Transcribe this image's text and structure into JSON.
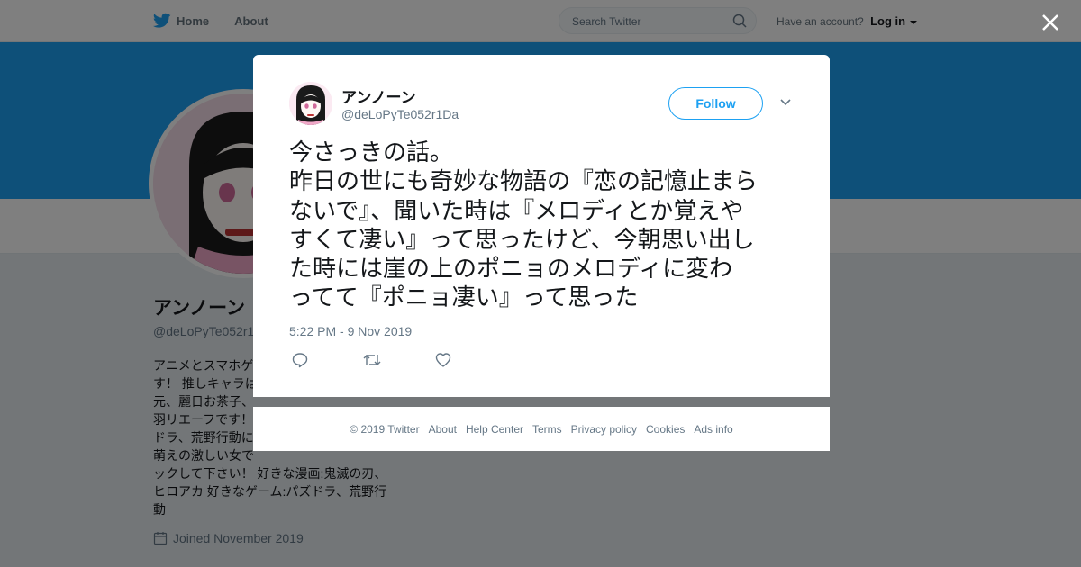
{
  "topbar": {
    "home_label": "Home",
    "about_label": "About",
    "search_placeholder": "Search Twitter",
    "account_prompt": "Have an account?",
    "login_label": "Log in"
  },
  "profile": {
    "name": "アンノーン",
    "handle": "@deLoPyTe052r1",
    "bio": "アニメとスマホゲ\nす！ 推しキャラは\n元、麗日お茶子、\n羽リエーフです！\nドラ、荒野行動に\n萌えの激しい女で\nックして下さい！ 好きな漫画:鬼滅の刃、\nヒロアカ 好きなゲーム:パズドラ、荒野行\n動",
    "joined": "Joined November 2019"
  },
  "tweet": {
    "author_name": "アンノーン",
    "author_handle": "@deLoPyTe052r1Da",
    "follow_label": "Follow",
    "text": "今さっきの話。\n昨日の世にも奇妙な物語の『恋の記憶止まら\nないで』、聞いた時は『メロディとか覚えや\nすくて凄い』って思ったけど、今朝思い出し\nた時には崖の上のポニョのメロディに変わ\nってて『ポニョ凄い』って思った",
    "timestamp": "5:22 PM - 9 Nov 2019"
  },
  "footer": {
    "links": [
      "© 2019 Twitter",
      "About",
      "Help Center",
      "Terms",
      "Privacy policy",
      "Cookies",
      "Ads info"
    ]
  },
  "colors": {
    "accent": "#1da1f2",
    "banner": "#1da1f2",
    "overlay": "rgba(0,0,0,0.5)"
  },
  "icons": [
    "twitter-bird-icon",
    "home-icon",
    "search-icon",
    "caret-down-icon",
    "close-icon",
    "chevron-down-icon",
    "reply-icon",
    "retweet-icon",
    "like-icon",
    "calendar-icon"
  ]
}
